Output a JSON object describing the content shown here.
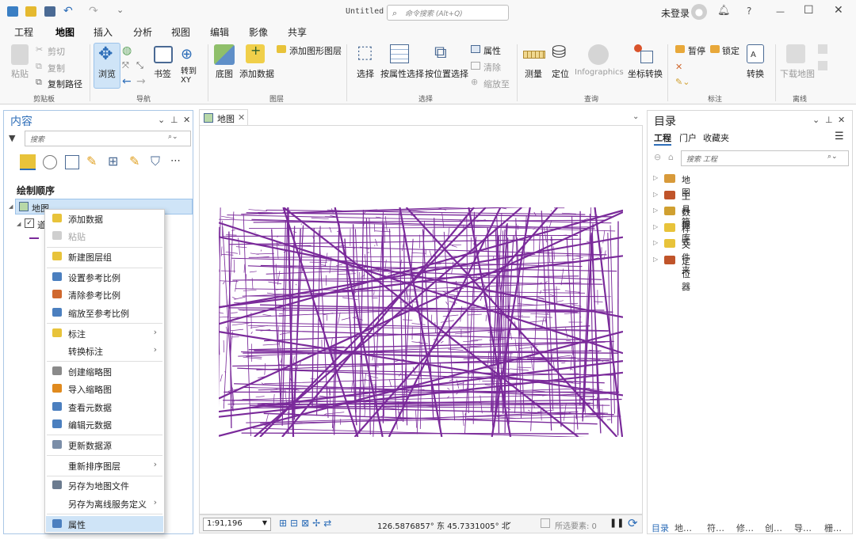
{
  "app": {
    "doc_title": "Untitled",
    "command_search_placeholder": "命令搜索 (Alt+Q)",
    "signin": "未登录",
    "help": "?",
    "min": "—",
    "max": "☐",
    "close": "✕"
  },
  "ribbon_tabs": [
    "工程",
    "地图",
    "插入",
    "分析",
    "视图",
    "编辑",
    "影像",
    "共享"
  ],
  "ribbon": {
    "paste": "粘贴",
    "cut": "剪切",
    "copy": "复制",
    "copy_path": "复制路径",
    "clipboard": "剪贴板",
    "explore": "浏览",
    "bookmarks": "书签",
    "goto_xy": "转到\nXY",
    "navigate": "导航",
    "basemap": "底图",
    "add_data": "添加数据",
    "add_graphics_layer": "添加图形图层",
    "layer": "图层",
    "select": "选择",
    "select_by_attr": "按属性选择",
    "select_by_loc": "按位置选择",
    "attributes": "属性",
    "clear": "清除",
    "zoom_to": "缩放至",
    "selection": "选择",
    "measure": "测量",
    "locate": "定位",
    "infographics": "Infographics",
    "convert_coords": "坐标转换",
    "inquiry": "查询",
    "pause": "暂停",
    "lock": "锁定",
    "convert": "转换",
    "labeling": "标注",
    "download_map": "下载地图",
    "offline": "离线"
  },
  "contents": {
    "title": "内容",
    "search_placeholder": "搜索",
    "draw_order": "绘制顺序",
    "map_item": "地图",
    "layer_item": "道"
  },
  "context_menu": [
    {
      "label": "添加数据",
      "icon": "add-data-icon",
      "color": "#e8c33a",
      "disabled": false,
      "submenu": false
    },
    {
      "label": "粘贴",
      "icon": "paste-icon",
      "color": "#cfcfcf",
      "disabled": true,
      "submenu": false
    },
    {
      "label": "新建图层组",
      "icon": "new-group-layer-icon",
      "color": "#e8c33a",
      "disabled": false,
      "submenu": false
    },
    {
      "label": "设置参考比例",
      "icon": "set-reference-scale-icon",
      "color": "#4b7fbf",
      "disabled": false,
      "submenu": false
    },
    {
      "label": "清除参考比例",
      "icon": "clear-reference-scale-icon",
      "color": "#d0682e",
      "disabled": false,
      "submenu": false
    },
    {
      "label": "缩放至参考比例",
      "icon": "zoom-reference-scale-icon",
      "color": "#4b7fbf",
      "disabled": false,
      "submenu": false
    },
    {
      "label": "标注",
      "icon": "label-icon",
      "color": "#e8c33a",
      "disabled": false,
      "submenu": true
    },
    {
      "label": "转换标注",
      "icon": "",
      "color": "",
      "disabled": false,
      "submenu": true
    },
    {
      "label": "创建缩略图",
      "icon": "create-thumbnail-icon",
      "color": "#8a8a8a",
      "disabled": false,
      "submenu": false
    },
    {
      "label": "导入缩略图",
      "icon": "import-thumbnail-icon",
      "color": "#e08a1e",
      "disabled": false,
      "submenu": false
    },
    {
      "label": "查看元数据",
      "icon": "view-metadata-icon",
      "color": "#4b7fbf",
      "disabled": false,
      "submenu": false
    },
    {
      "label": "编辑元数据",
      "icon": "edit-metadata-icon",
      "color": "#4b7fbf",
      "disabled": false,
      "submenu": false
    },
    {
      "label": "更新数据源",
      "icon": "update-data-source-icon",
      "color": "#7b8ea8",
      "disabled": false,
      "submenu": false
    },
    {
      "label": "重新排序图层",
      "icon": "",
      "color": "",
      "disabled": false,
      "submenu": true
    },
    {
      "label": "另存为地图文件",
      "icon": "save-map-file-icon",
      "color": "#6b7b8f",
      "disabled": false,
      "submenu": false
    },
    {
      "label": "另存为离线服务定义",
      "icon": "",
      "color": "",
      "disabled": false,
      "submenu": true
    },
    {
      "label": "属性",
      "icon": "properties-icon",
      "color": "#4b7fbf",
      "disabled": false,
      "submenu": false,
      "selected": true
    }
  ],
  "map": {
    "tab_label": "地图",
    "scale": "1:91,196",
    "coords": "126.5876857° 东 45.7331005° 北",
    "selected_features": "所选要素: 0",
    "road_color": "#7a2a9a"
  },
  "catalog": {
    "title": "目录",
    "tabs": [
      "工程",
      "门户",
      "收藏夹"
    ],
    "search_placeholder": "搜索 工程",
    "items": [
      "地图",
      "工具箱",
      "数据库",
      "样式",
      "文件夹",
      "定位器"
    ],
    "bottom_tabs": [
      "目录",
      "地…",
      "符…",
      "修…",
      "创…",
      "导…",
      "栅…"
    ]
  },
  "accent": "#2e6eb8"
}
